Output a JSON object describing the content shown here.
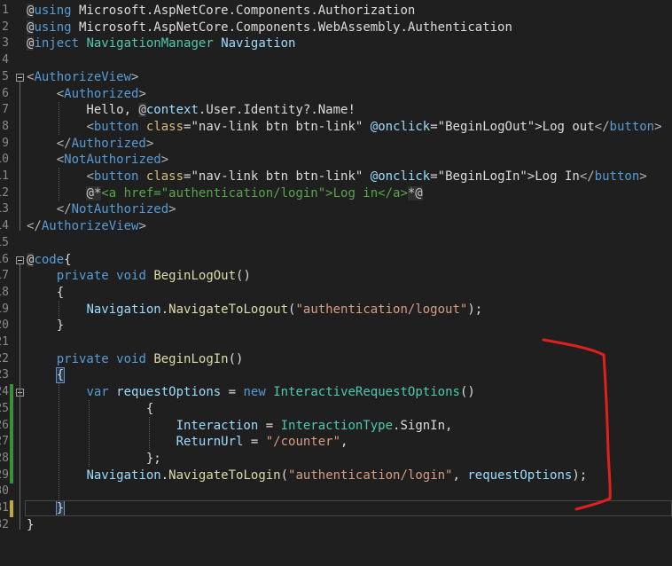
{
  "editor": {
    "lines": [
      {
        "n": "1",
        "tokens": [
          {
            "c": "razor",
            "t": "@"
          },
          {
            "c": "kw",
            "t": "using"
          },
          {
            "c": "plain",
            "t": " Microsoft.AspNetCore.Components.Authorization"
          }
        ]
      },
      {
        "n": "2",
        "tokens": [
          {
            "c": "razor",
            "t": "@"
          },
          {
            "c": "kw",
            "t": "using"
          },
          {
            "c": "plain",
            "t": " Microsoft.AspNetCore.Components.WebAssembly.Authentication"
          }
        ]
      },
      {
        "n": "3",
        "tokens": [
          {
            "c": "razor",
            "t": "@"
          },
          {
            "c": "kw",
            "t": "inject"
          },
          {
            "c": "plain",
            "t": " "
          },
          {
            "c": "type",
            "t": "NavigationManager"
          },
          {
            "c": "plain",
            "t": " "
          },
          {
            "c": "ident",
            "t": "Navigation"
          }
        ]
      },
      {
        "n": "4",
        "tokens": []
      },
      {
        "n": "5",
        "tokens": [
          {
            "c": "punct",
            "t": "<"
          },
          {
            "c": "tag",
            "t": "AuthorizeView"
          },
          {
            "c": "punct",
            "t": ">"
          }
        ]
      },
      {
        "n": "6",
        "tokens": [
          {
            "c": "plain",
            "t": "    "
          },
          {
            "c": "punct",
            "t": "<"
          },
          {
            "c": "tag",
            "t": "Authorized"
          },
          {
            "c": "punct",
            "t": ">"
          }
        ]
      },
      {
        "n": "7",
        "tokens": [
          {
            "c": "plain",
            "t": "        Hello, "
          },
          {
            "c": "razor",
            "t": "@"
          },
          {
            "c": "ident",
            "t": "context"
          },
          {
            "c": "plain",
            "t": ".User.Identity?.Name!"
          }
        ]
      },
      {
        "n": "8",
        "tokens": [
          {
            "c": "plain",
            "t": "        "
          },
          {
            "c": "punct",
            "t": "<"
          },
          {
            "c": "tag",
            "t": "button"
          },
          {
            "c": "plain",
            "t": " "
          },
          {
            "c": "attr",
            "t": "class"
          },
          {
            "c": "plain",
            "t": "="
          },
          {
            "c": "plain",
            "t": "\"nav-link btn btn-link\""
          },
          {
            "c": "plain",
            "t": " "
          },
          {
            "c": "attrname",
            "t": "@onclick"
          },
          {
            "c": "plain",
            "t": "=\"BeginLogOut\">Log out"
          },
          {
            "c": "punct",
            "t": "</"
          },
          {
            "c": "tag",
            "t": "button"
          },
          {
            "c": "punct",
            "t": ">"
          }
        ]
      },
      {
        "n": "9",
        "tokens": [
          {
            "c": "plain",
            "t": "    "
          },
          {
            "c": "punct",
            "t": "</"
          },
          {
            "c": "tag",
            "t": "Authorized"
          },
          {
            "c": "punct",
            "t": ">"
          }
        ]
      },
      {
        "n": "10",
        "tokens": [
          {
            "c": "plain",
            "t": "    "
          },
          {
            "c": "punct",
            "t": "<"
          },
          {
            "c": "tag",
            "t": "NotAuthorized"
          },
          {
            "c": "punct",
            "t": ">"
          }
        ]
      },
      {
        "n": "11",
        "tokens": [
          {
            "c": "plain",
            "t": "        "
          },
          {
            "c": "punct",
            "t": "<"
          },
          {
            "c": "tag",
            "t": "button"
          },
          {
            "c": "plain",
            "t": " "
          },
          {
            "c": "attr",
            "t": "class"
          },
          {
            "c": "plain",
            "t": "="
          },
          {
            "c": "plain",
            "t": "\"nav-link btn btn-link\""
          },
          {
            "c": "plain",
            "t": " "
          },
          {
            "c": "attrname",
            "t": "@onclick"
          },
          {
            "c": "plain",
            "t": "=\"BeginLogIn\">Log In"
          },
          {
            "c": "punct",
            "t": "</"
          },
          {
            "c": "tag",
            "t": "button"
          },
          {
            "c": "punct",
            "t": ">"
          }
        ]
      },
      {
        "n": "12",
        "tokens": [
          {
            "c": "plain",
            "t": "        "
          },
          {
            "c": "razor",
            "t": "@*"
          },
          {
            "c": "comment",
            "t": "<a href=\"authentication/login\">Log in</a>"
          },
          {
            "c": "razor",
            "t": "*@"
          }
        ]
      },
      {
        "n": "13",
        "tokens": [
          {
            "c": "plain",
            "t": "    "
          },
          {
            "c": "punct",
            "t": "</"
          },
          {
            "c": "tag",
            "t": "NotAuthorized"
          },
          {
            "c": "punct",
            "t": ">"
          }
        ]
      },
      {
        "n": "14",
        "tokens": [
          {
            "c": "punct",
            "t": "</"
          },
          {
            "c": "tag",
            "t": "AuthorizeView"
          },
          {
            "c": "punct",
            "t": ">"
          }
        ]
      },
      {
        "n": "15",
        "tokens": []
      },
      {
        "n": "16",
        "tokens": [
          {
            "c": "razor",
            "t": "@"
          },
          {
            "c": "kw",
            "t": "code"
          },
          {
            "c": "plain",
            "t": "{"
          }
        ]
      },
      {
        "n": "17",
        "tokens": [
          {
            "c": "plain",
            "t": "    "
          },
          {
            "c": "kw",
            "t": "private"
          },
          {
            "c": "plain",
            "t": " "
          },
          {
            "c": "kw",
            "t": "void"
          },
          {
            "c": "plain",
            "t": " "
          },
          {
            "c": "method",
            "t": "BeginLogOut"
          },
          {
            "c": "plain",
            "t": "()"
          }
        ]
      },
      {
        "n": "18",
        "tokens": [
          {
            "c": "plain",
            "t": "    {"
          }
        ]
      },
      {
        "n": "19",
        "tokens": [
          {
            "c": "plain",
            "t": "        "
          },
          {
            "c": "ident",
            "t": "Navigation"
          },
          {
            "c": "plain",
            "t": "."
          },
          {
            "c": "method",
            "t": "NavigateToLogout"
          },
          {
            "c": "plain",
            "t": "("
          },
          {
            "c": "str",
            "t": "\"authentication/logout\""
          },
          {
            "c": "plain",
            "t": ");"
          }
        ]
      },
      {
        "n": "20",
        "tokens": [
          {
            "c": "plain",
            "t": "    }"
          }
        ]
      },
      {
        "n": "21",
        "tokens": []
      },
      {
        "n": "22",
        "tokens": [
          {
            "c": "plain",
            "t": "    "
          },
          {
            "c": "kw",
            "t": "private"
          },
          {
            "c": "plain",
            "t": " "
          },
          {
            "c": "kw",
            "t": "void"
          },
          {
            "c": "plain",
            "t": " "
          },
          {
            "c": "method",
            "t": "BeginLogIn"
          },
          {
            "c": "plain",
            "t": "()"
          }
        ]
      },
      {
        "n": "23",
        "tokens": [
          {
            "c": "plain",
            "t": "    "
          },
          {
            "c": "bracehl",
            "t": "{"
          }
        ]
      },
      {
        "n": "24",
        "tokens": [
          {
            "c": "plain",
            "t": "        "
          },
          {
            "c": "kw",
            "t": "var"
          },
          {
            "c": "plain",
            "t": " "
          },
          {
            "c": "ident",
            "t": "requestOptions"
          },
          {
            "c": "plain",
            "t": " = "
          },
          {
            "c": "kw",
            "t": "new"
          },
          {
            "c": "plain",
            "t": " "
          },
          {
            "c": "type",
            "t": "InteractiveRequestOptions"
          },
          {
            "c": "plain",
            "t": "()"
          }
        ]
      },
      {
        "n": "25",
        "tokens": [
          {
            "c": "plain",
            "t": "                {"
          }
        ]
      },
      {
        "n": "26",
        "tokens": [
          {
            "c": "plain",
            "t": "                    "
          },
          {
            "c": "ident",
            "t": "Interaction"
          },
          {
            "c": "plain",
            "t": " = "
          },
          {
            "c": "type",
            "t": "InteractionType"
          },
          {
            "c": "plain",
            "t": ".SignIn,"
          }
        ]
      },
      {
        "n": "27",
        "tokens": [
          {
            "c": "plain",
            "t": "                    "
          },
          {
            "c": "ident",
            "t": "ReturnUrl"
          },
          {
            "c": "plain",
            "t": " = "
          },
          {
            "c": "str",
            "t": "\"/counter\""
          },
          {
            "c": "plain",
            "t": ","
          }
        ]
      },
      {
        "n": "28",
        "tokens": [
          {
            "c": "plain",
            "t": "                };"
          }
        ]
      },
      {
        "n": "29",
        "tokens": [
          {
            "c": "plain",
            "t": "        "
          },
          {
            "c": "ident",
            "t": "Navigation"
          },
          {
            "c": "plain",
            "t": "."
          },
          {
            "c": "method",
            "t": "NavigateToLogin"
          },
          {
            "c": "plain",
            "t": "("
          },
          {
            "c": "str",
            "t": "\"authentication/login\""
          },
          {
            "c": "plain",
            "t": ", "
          },
          {
            "c": "ident",
            "t": "requestOptions"
          },
          {
            "c": "plain",
            "t": ");"
          }
        ]
      },
      {
        "n": "30",
        "tokens": []
      },
      {
        "n": "31",
        "tokens": [
          {
            "c": "plain",
            "t": "    "
          },
          {
            "c": "bracehl",
            "t": "}"
          }
        ]
      },
      {
        "n": "32",
        "tokens": [
          {
            "c": "plain",
            "t": "}"
          }
        ]
      }
    ]
  },
  "colors": {
    "background": "#1f1f1f",
    "annotation": "#e0201c",
    "change_bar_saved": "#3a8f3a",
    "change_bar_unsaved": "#c2a83a"
  }
}
